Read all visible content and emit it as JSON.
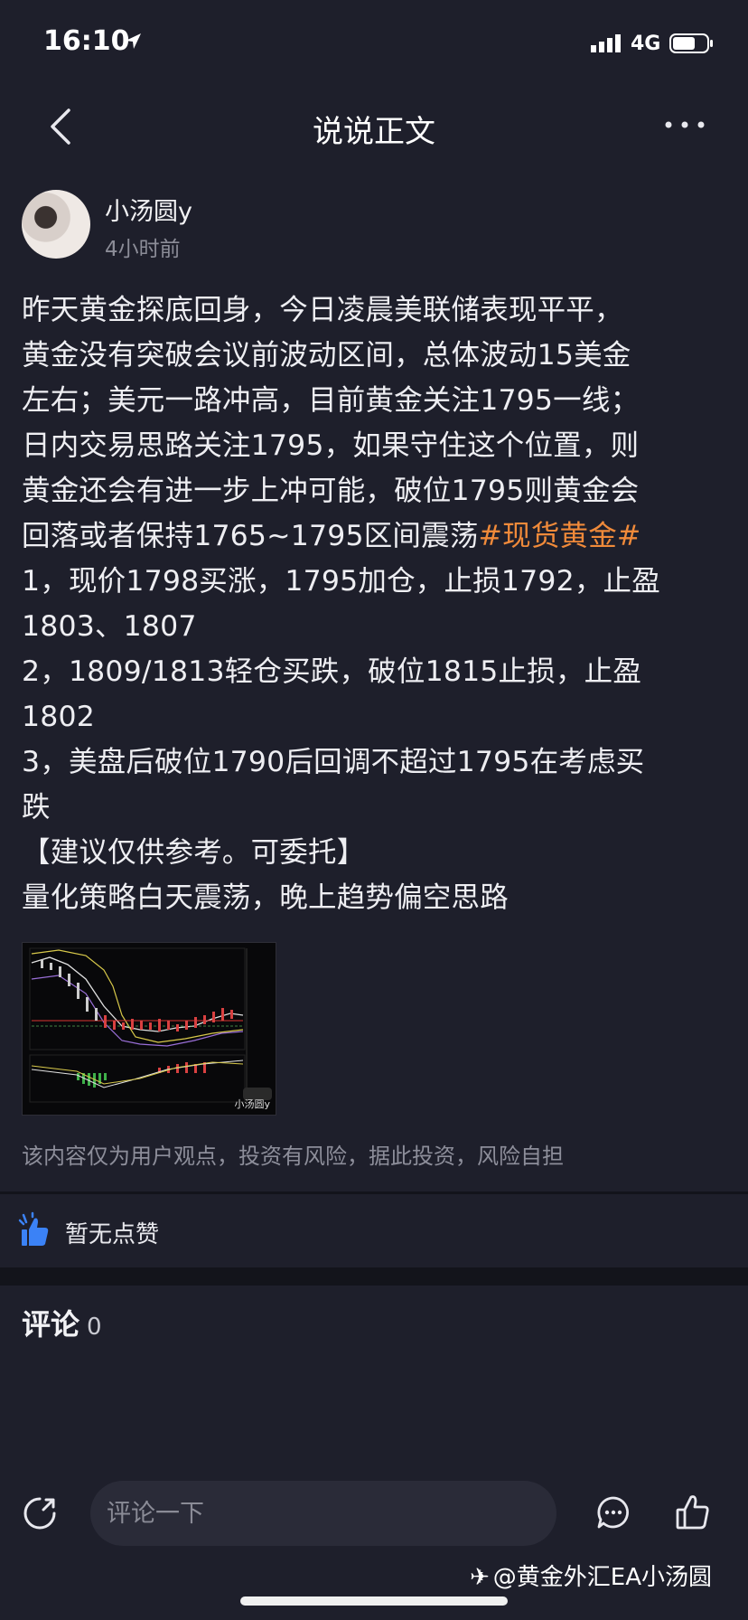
{
  "status_bar": {
    "time": "16:10",
    "network": "4G"
  },
  "nav": {
    "title": "说说正文"
  },
  "post": {
    "author": "小汤圆y",
    "time": "4小时前",
    "lines": [
      "昨天黄金探底回身，今日凌晨美联储表现平平，",
      "黄金没有突破会议前波动区间，总体波动15美金",
      "左右；美元一路冲高，目前黄金关注1795一线；",
      "日内交易思路关注1795，如果守住这个位置，则",
      "黄金还会有进一步上冲可能，破位1795则黄金会",
      "回落或者保持1765~1795区间震荡",
      "1，现价1798买涨，1795加仓，止损1792，止盈",
      "1803、1807",
      "2，1809/1813轻仓买跌，破位1815止损，止盈",
      "1802",
      "3，美盘后破位1790后回调不超过1795在考虑买",
      "跌",
      "【建议仅供参考。可委托】",
      "量化策略白天震荡，晚上趋势偏空思路"
    ],
    "hashtag": "#现货黄金#",
    "image": {
      "watermark": "小汤圆y"
    },
    "disclaimer": "该内容仅为用户观点，投资有风险，据此投资，风险自担"
  },
  "likes": {
    "label": "暂无点赞"
  },
  "comments": {
    "title": "评论",
    "count": "0"
  },
  "bottom_bar": {
    "input_placeholder": "评论一下"
  },
  "watermark": {
    "text": "@黄金外汇EA小汤圆"
  },
  "colors": {
    "background": "#1e1f2b",
    "hashtag": "#f08a3a",
    "like_icon": "#3b82f6"
  }
}
